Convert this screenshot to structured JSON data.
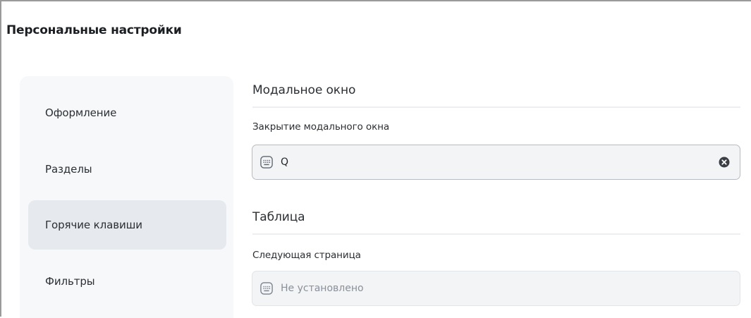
{
  "page": {
    "title": "Персональные настройки"
  },
  "sidebar": {
    "items": [
      {
        "label": "Оформление",
        "active": false
      },
      {
        "label": "Разделы",
        "active": false
      },
      {
        "label": "Горячие клавиши",
        "active": true
      },
      {
        "label": "Фильтры",
        "active": false
      }
    ]
  },
  "sections": [
    {
      "title": "Модальное окно",
      "field": {
        "label": "Закрытие модального окна",
        "value": "Q",
        "icon": "keyboard-icon",
        "clear_icon": "close-circle-icon"
      }
    },
    {
      "title": "Таблица",
      "field": {
        "label": "Следующая страница",
        "placeholder": "Не установлено",
        "icon": "keyboard-icon"
      }
    }
  ],
  "colors": {
    "active_nav_bg": "#e6e9ee",
    "sidebar_bg": "#f7f8fa",
    "field_bg": "#f3f4f6"
  }
}
